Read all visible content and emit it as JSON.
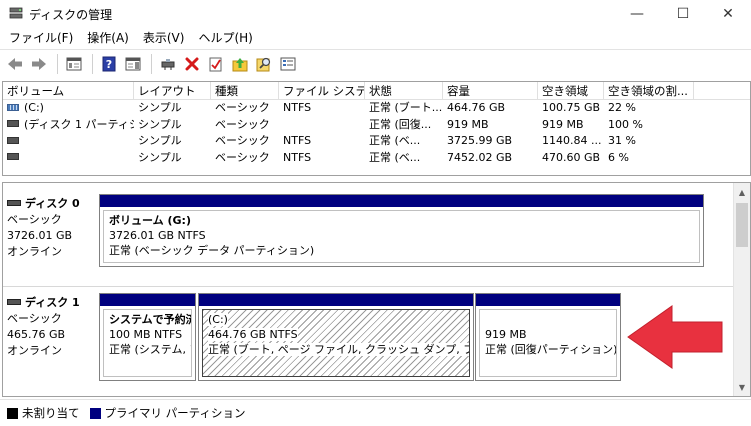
{
  "window": {
    "title": "ディスクの管理",
    "controls": {
      "minimize": "—",
      "maximize": "☐",
      "close": "✕"
    }
  },
  "menu": {
    "items": [
      "ファイル(F)",
      "操作(A)",
      "表示(V)",
      "ヘルプ(H)"
    ]
  },
  "toolbar": {
    "buttons": [
      "back-arrow-icon",
      "forward-arrow-icon",
      "console-tree-icon",
      "help-icon",
      "action-pane-icon",
      "connect-drive-icon",
      "delete-icon",
      "properties-check-icon",
      "folder-up-icon",
      "search-icon",
      "list-view-icon"
    ]
  },
  "volume_list": {
    "columns": [
      "ボリューム",
      "レイアウト",
      "種類",
      "ファイル システム",
      "状態",
      "容量",
      "空き領域",
      "空き領域の割..."
    ],
    "rows": [
      [
        "(C:)",
        "シンプル",
        "ベーシック",
        "NTFS",
        "正常 (ブート...",
        "464.76 GB",
        "100.75 GB",
        "22 %"
      ],
      [
        "(ディスク 1 パーティシ...",
        "シンプル",
        "ベーシック",
        "",
        "正常 (回復...",
        "919 MB",
        "919 MB",
        "100 %"
      ],
      [
        "",
        "シンプル",
        "ベーシック",
        "NTFS",
        "正常 (ベ...",
        "3725.99 GB",
        "1140.84 ...",
        "31 %"
      ],
      [
        "",
        "シンプル",
        "ベーシック",
        "NTFS",
        "正常 (ベ...",
        "7452.02 GB",
        "470.60 GB",
        "6 %"
      ]
    ]
  },
  "disks": [
    {
      "name": "ディスク 0",
      "type": "ベーシック",
      "size": "3726.01 GB",
      "status": "オンライン",
      "partitions": [
        {
          "title": "ボリューム (G:)",
          "size": "3726.01 GB NTFS",
          "status": "正常 (ベーシック データ パーティション)"
        }
      ]
    },
    {
      "name": "ディスク 1",
      "type": "ベーシック",
      "size": "465.76 GB",
      "status": "オンライン",
      "partitions": [
        {
          "title": "システムで予約済",
          "size": "100 MB NTFS",
          "status": "正常 (システム, ア"
        },
        {
          "title": "(C:)",
          "size": "464.76 GB NTFS",
          "status": "正常 (ブート, ページ ファイル, クラッシュ ダンプ, プライマリ パ"
        },
        {
          "title": "",
          "size": "919 MB",
          "status": "正常 (回復パーティション)"
        }
      ]
    }
  ],
  "legend": {
    "items": [
      {
        "label": "未割り当て",
        "color": "#000000"
      },
      {
        "label": "プライマリ パーティション",
        "color": "#00007f"
      }
    ]
  },
  "colors": {
    "partition_bar": "#00007f",
    "arrow": "#e8313f"
  }
}
